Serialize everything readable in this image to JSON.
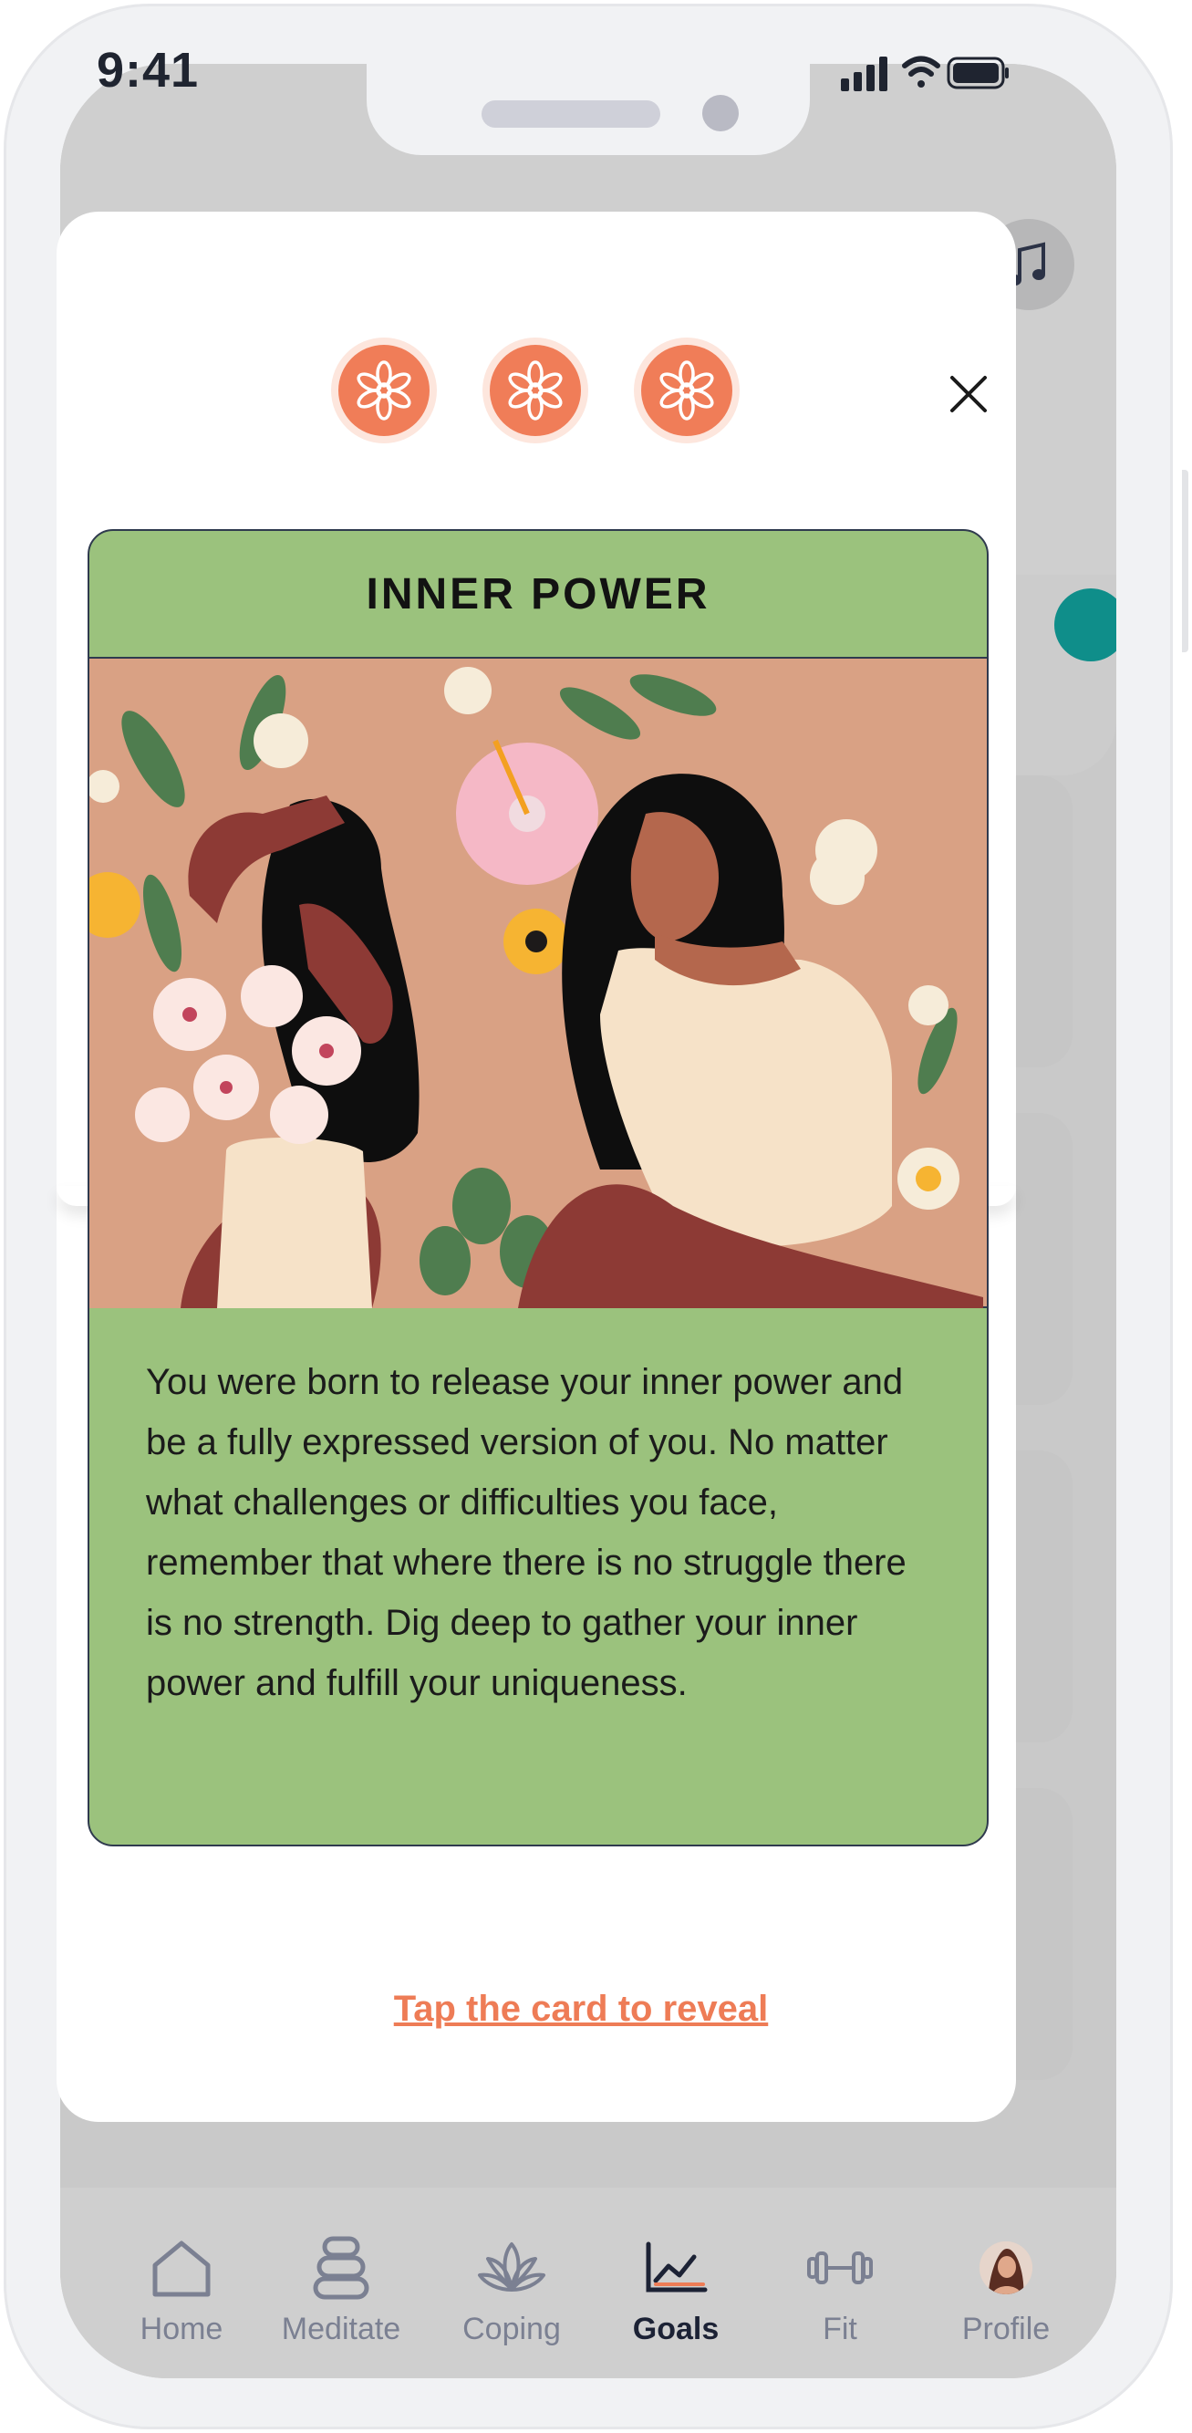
{
  "status_bar": {
    "time": "9:41"
  },
  "modal": {
    "close_icon": "close-icon",
    "draw_tokens": [
      "mandala-token-icon",
      "mandala-token-icon",
      "mandala-token-icon"
    ],
    "card": {
      "title": "INNER POWER",
      "illustration": "two-women-among-flowers-illustration",
      "body": "You were born to release your inner power and be a fully expressed version of you. No matter what challenges or difficulties you face, remember that where there is no struggle there is no strength. Dig deep to gather your inner power and fulfill your uniqueness."
    },
    "reveal_link": "Tap the card to reveal"
  },
  "tab_bar": {
    "active": "Goals",
    "tabs": [
      {
        "label": "Home",
        "icon": "home-icon"
      },
      {
        "label": "Meditate",
        "icon": "stones-icon"
      },
      {
        "label": "Coping",
        "icon": "lotus-icon"
      },
      {
        "label": "Goals",
        "icon": "chart-icon"
      },
      {
        "label": "Fit",
        "icon": "dumbbell-icon"
      },
      {
        "label": "Profile",
        "icon": "avatar"
      }
    ]
  },
  "colors": {
    "accent": "#EE7C56",
    "card_green": "#9BC27D",
    "token_orange": "#F07D58",
    "art_background": "#D9A184",
    "teal": "#0F8E8A"
  }
}
